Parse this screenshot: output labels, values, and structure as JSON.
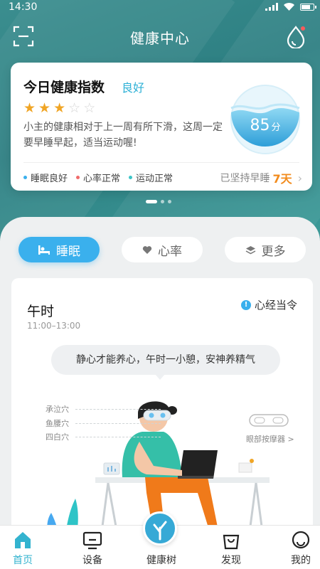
{
  "status": {
    "time": "14:30"
  },
  "header": {
    "title": "健康中心"
  },
  "index_card": {
    "title": "今日健康指数",
    "grade": "良好",
    "stars": {
      "filled": 3,
      "total": 5
    },
    "description": "小主的健康相对于上一周有所下滑，这周一定要早睡早起，适当运动喔!",
    "score": "85",
    "score_unit": "分",
    "legend": [
      {
        "label": "睡眠良好",
        "color": "#3ab0ed"
      },
      {
        "label": "心率正常",
        "color": "#f06b6b"
      },
      {
        "label": "运动正常",
        "color": "#3cc5c7"
      }
    ],
    "streak_prefix": "已坚持早睡",
    "streak_days": "7天"
  },
  "pager": {
    "pages": 3,
    "current": 0
  },
  "tabs": [
    {
      "label": "睡眠",
      "icon": "sleep-icon",
      "active": true
    },
    {
      "label": "心率",
      "icon": "heart-icon",
      "active": false
    },
    {
      "label": "更多",
      "icon": "layers-icon",
      "active": false
    }
  ],
  "content": {
    "period": "午时",
    "range": "11:00–13:00",
    "meridian": "心经当令",
    "tip": "静心才能养心，午时一小憩，安神养精气",
    "acupoints": [
      "承泣穴",
      "鱼腰穴",
      "四白穴"
    ],
    "device_label": "眼部按摩器 >"
  },
  "tabbar": [
    {
      "label": "首页",
      "active": true
    },
    {
      "label": "设备",
      "active": false
    },
    {
      "label": "健康树",
      "active": false
    },
    {
      "label": "发现",
      "active": false
    },
    {
      "label": "我的",
      "active": false
    }
  ],
  "colors": {
    "accent": "#3ab0ed",
    "teal": "#2d7f82",
    "orange": "#f28b1c",
    "star": "#f0a525"
  }
}
